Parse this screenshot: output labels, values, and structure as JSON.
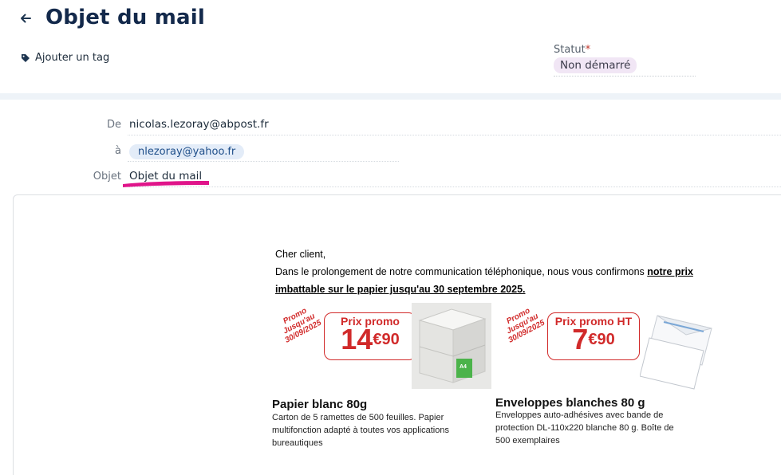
{
  "header": {
    "title": "Objet du mail",
    "add_tag_label": "Ajouter un tag",
    "status_label": "Statut",
    "status_required_mark": "*",
    "status_value": "Non démarré",
    "status_color": "#f1e6f5"
  },
  "fields": {
    "from_label": "De",
    "from_value": "nicolas.lezoray@abpost.fr",
    "to_label": "à",
    "to_value": "nlezoray@yahoo.fr",
    "subject_label": "Objet",
    "subject_value": "Objet du mail"
  },
  "icons": {
    "back": "arrow-left-icon",
    "tag": "tag-icon"
  },
  "email": {
    "greeting": "Cher client,",
    "intro": "Dans le prolongement de notre communication téléphonique, nous vous confirmons ",
    "intro_emphasis": "notre prix imbattable sur le papier jusqu'au 30 septembre 2025.",
    "promo_stamp_1": "Promo Jusqu'au 30/09/2025",
    "promo_stamp_2": "Promo Jusqu'au 30/09/2025",
    "product_1": {
      "promo_label": "Prix promo",
      "price_main": "14",
      "price_cents": "€90",
      "box_label": "A4",
      "title": "Papier blanc 80g",
      "description": "Carton de 5 ramettes de 500 feuilles. Papier multifonction adapté à toutes vos applications bureautiques"
    },
    "product_2": {
      "promo_label": "Prix promo HT",
      "price_main": "7",
      "price_cents": "€90",
      "title": "Enveloppes blanches 80 g",
      "description": "Enveloppes auto-adhésives avec bande de protection DL-110x220 blanche 80 g. Boîte de 500 exemplaires"
    }
  },
  "colors": {
    "title": "#13294b",
    "promo_red": "#d12a2a",
    "chip_bg": "#e3ecf8",
    "highlight": "#e0148a"
  }
}
